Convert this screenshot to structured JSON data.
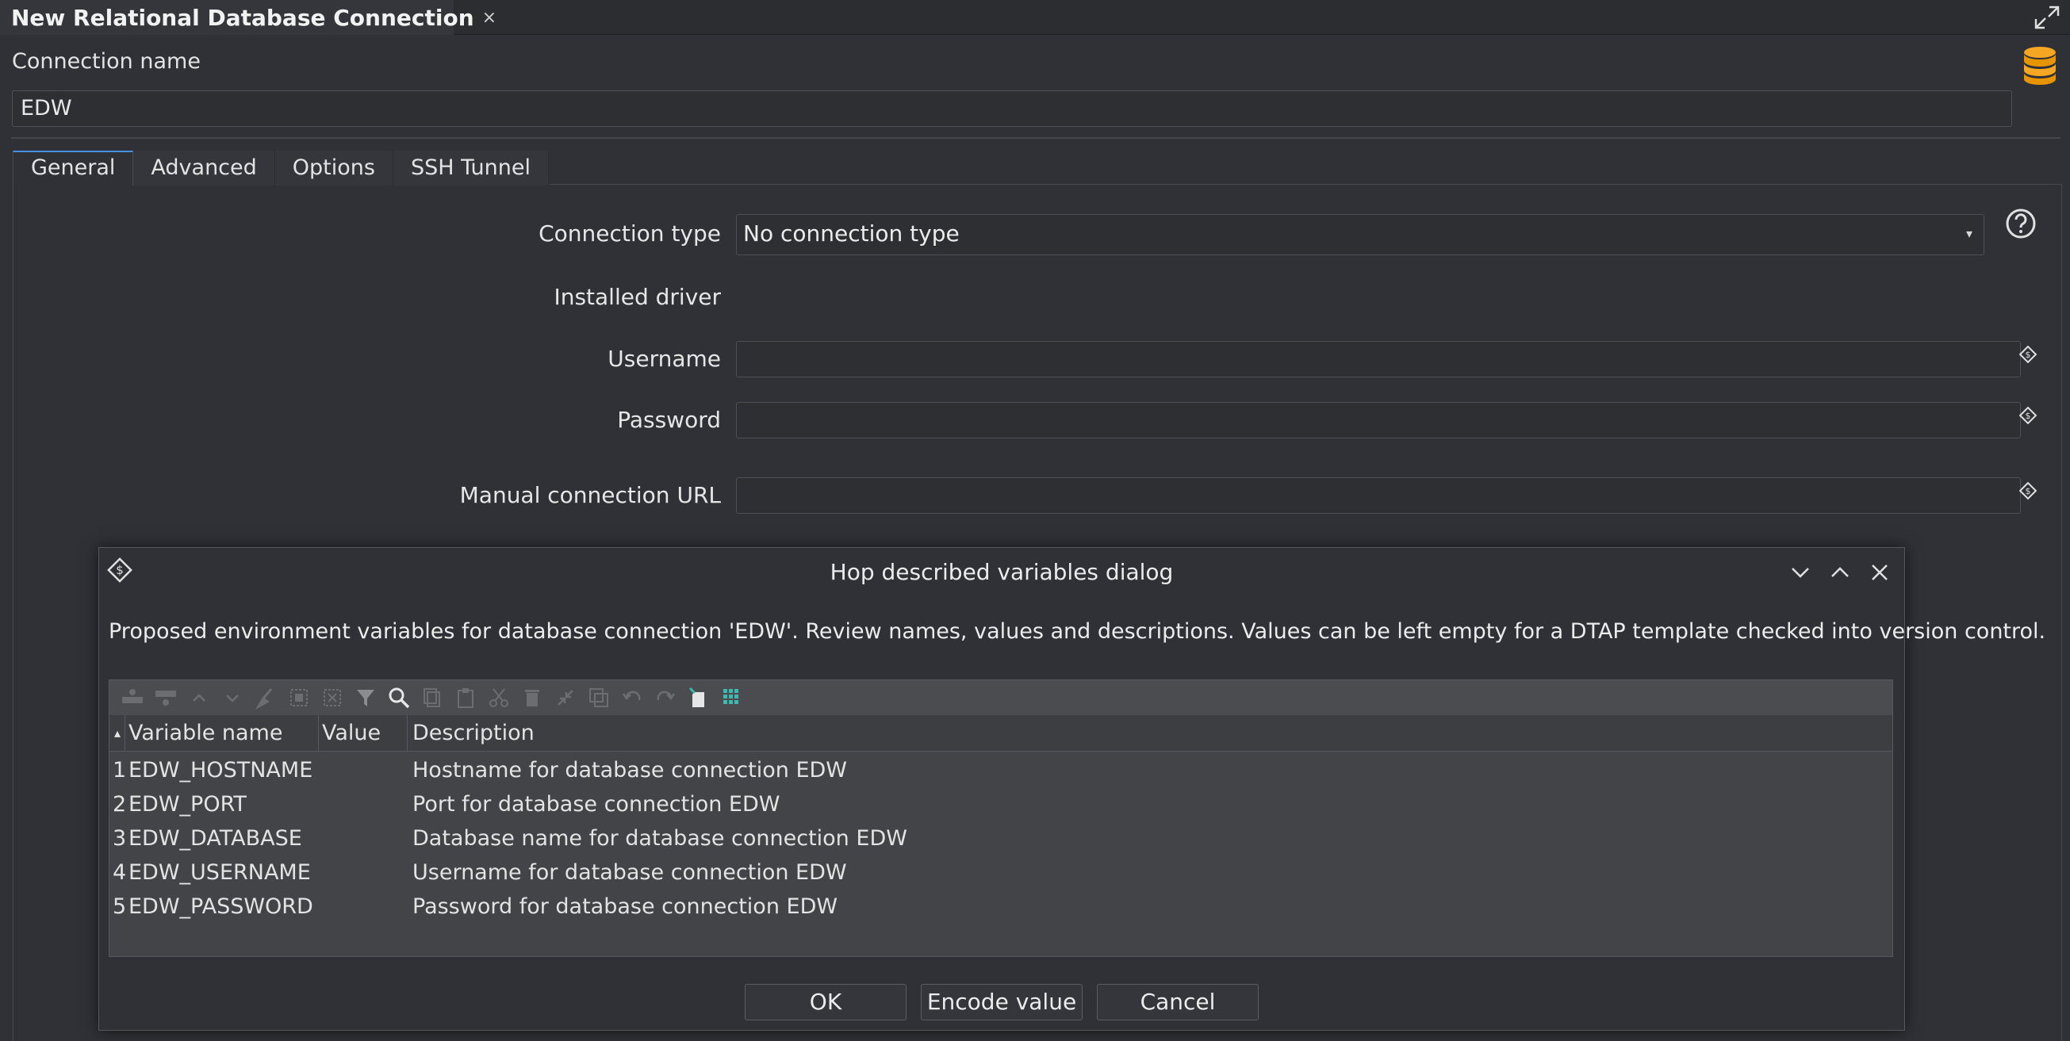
{
  "editor_tab": {
    "title": "New Relational Database Connection",
    "close": "×"
  },
  "connection_name": {
    "label": "Connection name",
    "value": "EDW"
  },
  "tabs": [
    {
      "label": "General",
      "active": true
    },
    {
      "label": "Advanced",
      "active": false
    },
    {
      "label": "Options",
      "active": false
    },
    {
      "label": "SSH Tunnel",
      "active": false
    }
  ],
  "general": {
    "connection_type_label": "Connection type",
    "connection_type_value": "No connection type",
    "installed_driver_label": "Installed driver",
    "username_label": "Username",
    "username_value": "",
    "password_label": "Password",
    "password_value": "",
    "manual_url_label": "Manual connection URL",
    "manual_url_value": ""
  },
  "dialog": {
    "title": "Hop described variables dialog",
    "message": "Proposed environment variables for database connection 'EDW'. Review names, values and descriptions. Values can be left empty for a DTAP template checked into version control.",
    "columns": {
      "sort": "▴",
      "name": "Variable name",
      "value": "Value",
      "description": "Description"
    },
    "rows": [
      {
        "num": "1",
        "name": "EDW_HOSTNAME",
        "value": "",
        "description": "Hostname for database connection EDW"
      },
      {
        "num": "2",
        "name": "EDW_PORT",
        "value": "",
        "description": "Port for database connection EDW"
      },
      {
        "num": "3",
        "name": "EDW_DATABASE",
        "value": "",
        "description": "Database name for database connection EDW"
      },
      {
        "num": "4",
        "name": "EDW_USERNAME",
        "value": "",
        "description": "Username for database connection EDW"
      },
      {
        "num": "5",
        "name": "EDW_PASSWORD",
        "value": "",
        "description": "Password for database connection EDW"
      }
    ],
    "buttons": {
      "ok": "OK",
      "encode": "Encode value",
      "cancel": "Cancel"
    }
  },
  "colors": {
    "background": "#2f3136",
    "accent": "#4a90e2",
    "logo": "#f0a30a",
    "teal_icon": "#3fb8af"
  }
}
